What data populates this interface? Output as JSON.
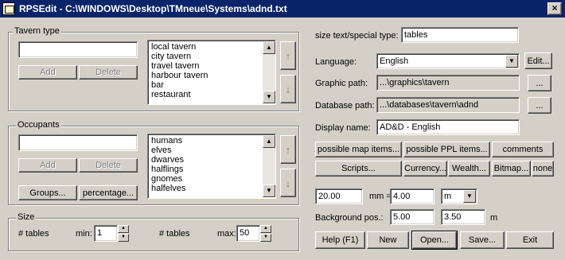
{
  "window": {
    "title": "RPSEdit - C:\\WINDOWS\\Desktop\\TMneue\\Systems\\adnd.txt",
    "close_glyph": "×"
  },
  "tavern": {
    "legend": "Tavern type",
    "input_value": "",
    "add_label": "Add",
    "delete_label": "Delete",
    "items": [
      "local tavern",
      "city tavern",
      "travel tavern",
      "harbour tavern",
      "bar",
      "restaurant"
    ]
  },
  "occupants": {
    "legend": "Occupants",
    "input_value": "",
    "add_label": "Add",
    "delete_label": "Delete",
    "groups_label": "Groups...",
    "percentage_label": "percentage...",
    "items": [
      "humans",
      "elves",
      "dwarves",
      "halflings",
      "gnomes",
      "halfelves"
    ]
  },
  "size": {
    "legend": "Size",
    "left_label": "# tables",
    "min_label": "min:",
    "min_value": "1",
    "right_label": "# tables",
    "max_label": "max:",
    "max_value": "50"
  },
  "right": {
    "size_text_label": "size text/special type:",
    "size_text_value": "tables",
    "language_label": "Language:",
    "language_value": "English",
    "edit_label": "Edit...",
    "graphic_label": "Graphic path:",
    "graphic_value": "...\\graphics\\tavern",
    "browse_label": "...",
    "database_label": "Database path:",
    "database_value": "...\\databases\\tavern\\adnd",
    "display_label": "Display name:",
    "display_value": "AD&D - English",
    "possible_map_label": "possible map items...",
    "possible_ppl_label": "possible PPL items...",
    "comments_label": "comments",
    "scripts_label": "Scripts...",
    "currency_label": "Currency...",
    "wealth_label": "Wealth...",
    "bitmap_label": "Bitmap...",
    "none_label": "none",
    "scale_left_value": "20.00",
    "scale_unit_left": "mm =",
    "scale_right_value": "4.00",
    "scale_unit_select": "m",
    "bg_label": "Background pos.:",
    "bg_x": "5.00",
    "bg_y": "3.50",
    "bg_unit": "m"
  },
  "footer": {
    "help_label": "Help (F1)",
    "new_label": "New",
    "open_label": "Open...",
    "save_label": "Save...",
    "exit_label": "Exit"
  }
}
